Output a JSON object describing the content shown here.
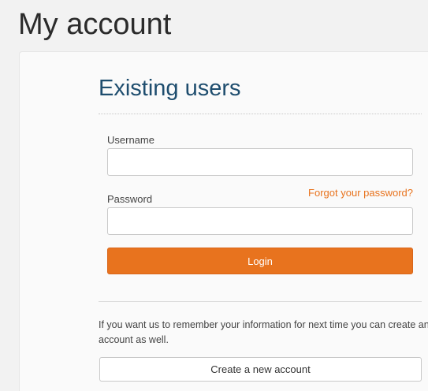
{
  "page": {
    "title": "My account"
  },
  "login": {
    "heading": "Existing users",
    "username_label": "Username",
    "username_value": "",
    "password_label": "Password",
    "password_value": "",
    "forgot_link": "Forgot your password?",
    "login_button": "Login"
  },
  "register": {
    "info": "If you want us to remember your information for next time you can create an account as well.",
    "create_button": "Create a new account"
  },
  "colors": {
    "accent": "#e8731e",
    "heading": "#1e4d6e"
  }
}
